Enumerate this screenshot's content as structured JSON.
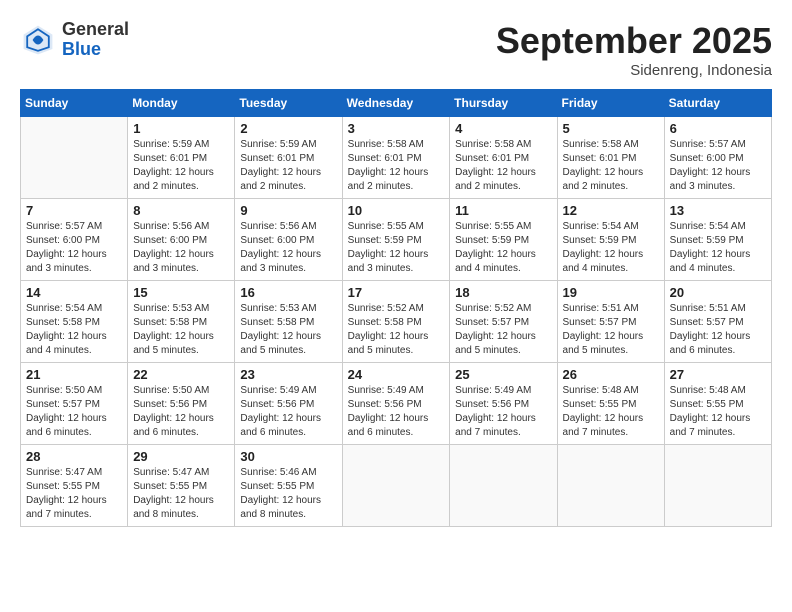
{
  "header": {
    "logo_general": "General",
    "logo_blue": "Blue",
    "month_title": "September 2025",
    "location": "Sidenreng, Indonesia"
  },
  "weekdays": [
    "Sunday",
    "Monday",
    "Tuesday",
    "Wednesday",
    "Thursday",
    "Friday",
    "Saturday"
  ],
  "weeks": [
    [
      {
        "day": "",
        "info": ""
      },
      {
        "day": "1",
        "info": "Sunrise: 5:59 AM\nSunset: 6:01 PM\nDaylight: 12 hours\nand 2 minutes."
      },
      {
        "day": "2",
        "info": "Sunrise: 5:59 AM\nSunset: 6:01 PM\nDaylight: 12 hours\nand 2 minutes."
      },
      {
        "day": "3",
        "info": "Sunrise: 5:58 AM\nSunset: 6:01 PM\nDaylight: 12 hours\nand 2 minutes."
      },
      {
        "day": "4",
        "info": "Sunrise: 5:58 AM\nSunset: 6:01 PM\nDaylight: 12 hours\nand 2 minutes."
      },
      {
        "day": "5",
        "info": "Sunrise: 5:58 AM\nSunset: 6:01 PM\nDaylight: 12 hours\nand 2 minutes."
      },
      {
        "day": "6",
        "info": "Sunrise: 5:57 AM\nSunset: 6:00 PM\nDaylight: 12 hours\nand 3 minutes."
      }
    ],
    [
      {
        "day": "7",
        "info": "Sunrise: 5:57 AM\nSunset: 6:00 PM\nDaylight: 12 hours\nand 3 minutes."
      },
      {
        "day": "8",
        "info": "Sunrise: 5:56 AM\nSunset: 6:00 PM\nDaylight: 12 hours\nand 3 minutes."
      },
      {
        "day": "9",
        "info": "Sunrise: 5:56 AM\nSunset: 6:00 PM\nDaylight: 12 hours\nand 3 minutes."
      },
      {
        "day": "10",
        "info": "Sunrise: 5:55 AM\nSunset: 5:59 PM\nDaylight: 12 hours\nand 3 minutes."
      },
      {
        "day": "11",
        "info": "Sunrise: 5:55 AM\nSunset: 5:59 PM\nDaylight: 12 hours\nand 4 minutes."
      },
      {
        "day": "12",
        "info": "Sunrise: 5:54 AM\nSunset: 5:59 PM\nDaylight: 12 hours\nand 4 minutes."
      },
      {
        "day": "13",
        "info": "Sunrise: 5:54 AM\nSunset: 5:59 PM\nDaylight: 12 hours\nand 4 minutes."
      }
    ],
    [
      {
        "day": "14",
        "info": "Sunrise: 5:54 AM\nSunset: 5:58 PM\nDaylight: 12 hours\nand 4 minutes."
      },
      {
        "day": "15",
        "info": "Sunrise: 5:53 AM\nSunset: 5:58 PM\nDaylight: 12 hours\nand 5 minutes."
      },
      {
        "day": "16",
        "info": "Sunrise: 5:53 AM\nSunset: 5:58 PM\nDaylight: 12 hours\nand 5 minutes."
      },
      {
        "day": "17",
        "info": "Sunrise: 5:52 AM\nSunset: 5:58 PM\nDaylight: 12 hours\nand 5 minutes."
      },
      {
        "day": "18",
        "info": "Sunrise: 5:52 AM\nSunset: 5:57 PM\nDaylight: 12 hours\nand 5 minutes."
      },
      {
        "day": "19",
        "info": "Sunrise: 5:51 AM\nSunset: 5:57 PM\nDaylight: 12 hours\nand 5 minutes."
      },
      {
        "day": "20",
        "info": "Sunrise: 5:51 AM\nSunset: 5:57 PM\nDaylight: 12 hours\nand 6 minutes."
      }
    ],
    [
      {
        "day": "21",
        "info": "Sunrise: 5:50 AM\nSunset: 5:57 PM\nDaylight: 12 hours\nand 6 minutes."
      },
      {
        "day": "22",
        "info": "Sunrise: 5:50 AM\nSunset: 5:56 PM\nDaylight: 12 hours\nand 6 minutes."
      },
      {
        "day": "23",
        "info": "Sunrise: 5:49 AM\nSunset: 5:56 PM\nDaylight: 12 hours\nand 6 minutes."
      },
      {
        "day": "24",
        "info": "Sunrise: 5:49 AM\nSunset: 5:56 PM\nDaylight: 12 hours\nand 6 minutes."
      },
      {
        "day": "25",
        "info": "Sunrise: 5:49 AM\nSunset: 5:56 PM\nDaylight: 12 hours\nand 7 minutes."
      },
      {
        "day": "26",
        "info": "Sunrise: 5:48 AM\nSunset: 5:55 PM\nDaylight: 12 hours\nand 7 minutes."
      },
      {
        "day": "27",
        "info": "Sunrise: 5:48 AM\nSunset: 5:55 PM\nDaylight: 12 hours\nand 7 minutes."
      }
    ],
    [
      {
        "day": "28",
        "info": "Sunrise: 5:47 AM\nSunset: 5:55 PM\nDaylight: 12 hours\nand 7 minutes."
      },
      {
        "day": "29",
        "info": "Sunrise: 5:47 AM\nSunset: 5:55 PM\nDaylight: 12 hours\nand 8 minutes."
      },
      {
        "day": "30",
        "info": "Sunrise: 5:46 AM\nSunset: 5:55 PM\nDaylight: 12 hours\nand 8 minutes."
      },
      {
        "day": "",
        "info": ""
      },
      {
        "day": "",
        "info": ""
      },
      {
        "day": "",
        "info": ""
      },
      {
        "day": "",
        "info": ""
      }
    ]
  ]
}
